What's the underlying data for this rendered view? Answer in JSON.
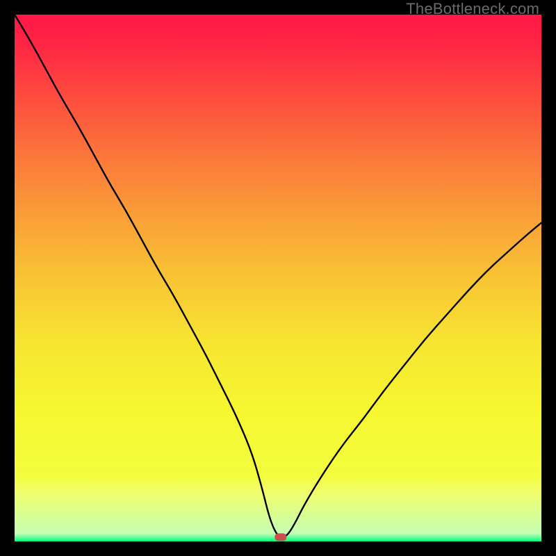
{
  "watermark": "TheBottleneck.com",
  "chart_data": {
    "type": "line",
    "title": "",
    "xlabel": "",
    "ylabel": "",
    "xlim": [
      0,
      100
    ],
    "ylim": [
      0,
      100
    ],
    "grid": false,
    "legend": false,
    "background": {
      "type": "vertical-heatmap-gradient",
      "description": "Vertical gradient from red (top, high bottleneck) through orange, yellow, to green (bottom, low bottleneck). A narrow green band sits at the very bottom.",
      "stops": [
        {
          "pos": 0.0,
          "color": "#FF1846"
        },
        {
          "pos": 0.05,
          "color": "#FF2344"
        },
        {
          "pos": 0.125,
          "color": "#FE4040"
        },
        {
          "pos": 0.25,
          "color": "#FC703B"
        },
        {
          "pos": 0.375,
          "color": "#FA9C38"
        },
        {
          "pos": 0.5,
          "color": "#F8C434"
        },
        {
          "pos": 0.625,
          "color": "#F7E531"
        },
        {
          "pos": 0.75,
          "color": "#F6F730"
        },
        {
          "pos": 0.875,
          "color": "#F3FD3E"
        },
        {
          "pos": 0.905,
          "color": "#F1FE6A"
        },
        {
          "pos": 0.985,
          "color": "#C5FEB3"
        },
        {
          "pos": 1.0,
          "color": "#00FF7E"
        }
      ]
    },
    "series": [
      {
        "name": "bottleneck-curve",
        "description": "Asymmetric V-shaped curve: steep fall from top-left, small flat minimum near x≈50, then rises with curvature toward the right reaching roughly 60% height at x=100.",
        "color": "#000000",
        "x": [
          0,
          3,
          6,
          9,
          12,
          15,
          18,
          21,
          24,
          27,
          30,
          33,
          36,
          39,
          42,
          45,
          47,
          48.5,
          50,
          51.5,
          53,
          55,
          58,
          62,
          66,
          70,
          74,
          78,
          82,
          86,
          90,
          94,
          97,
          100
        ],
        "y": [
          100,
          95,
          89.5,
          84,
          79,
          73.5,
          68,
          63,
          57.5,
          52,
          47,
          41.5,
          36,
          30,
          24,
          17,
          10,
          4,
          0.8,
          0.8,
          3,
          7,
          12,
          18,
          23,
          28.5,
          33.5,
          38.5,
          43,
          47.5,
          51.7,
          55.3,
          58,
          60.5
        ]
      }
    ],
    "marker": {
      "description": "Rounded red pill marking the optimal (minimum) point at the curve trough.",
      "x": 50.5,
      "y": 0.8,
      "color": "#CC4F4F",
      "shape": "rounded-rect"
    }
  }
}
